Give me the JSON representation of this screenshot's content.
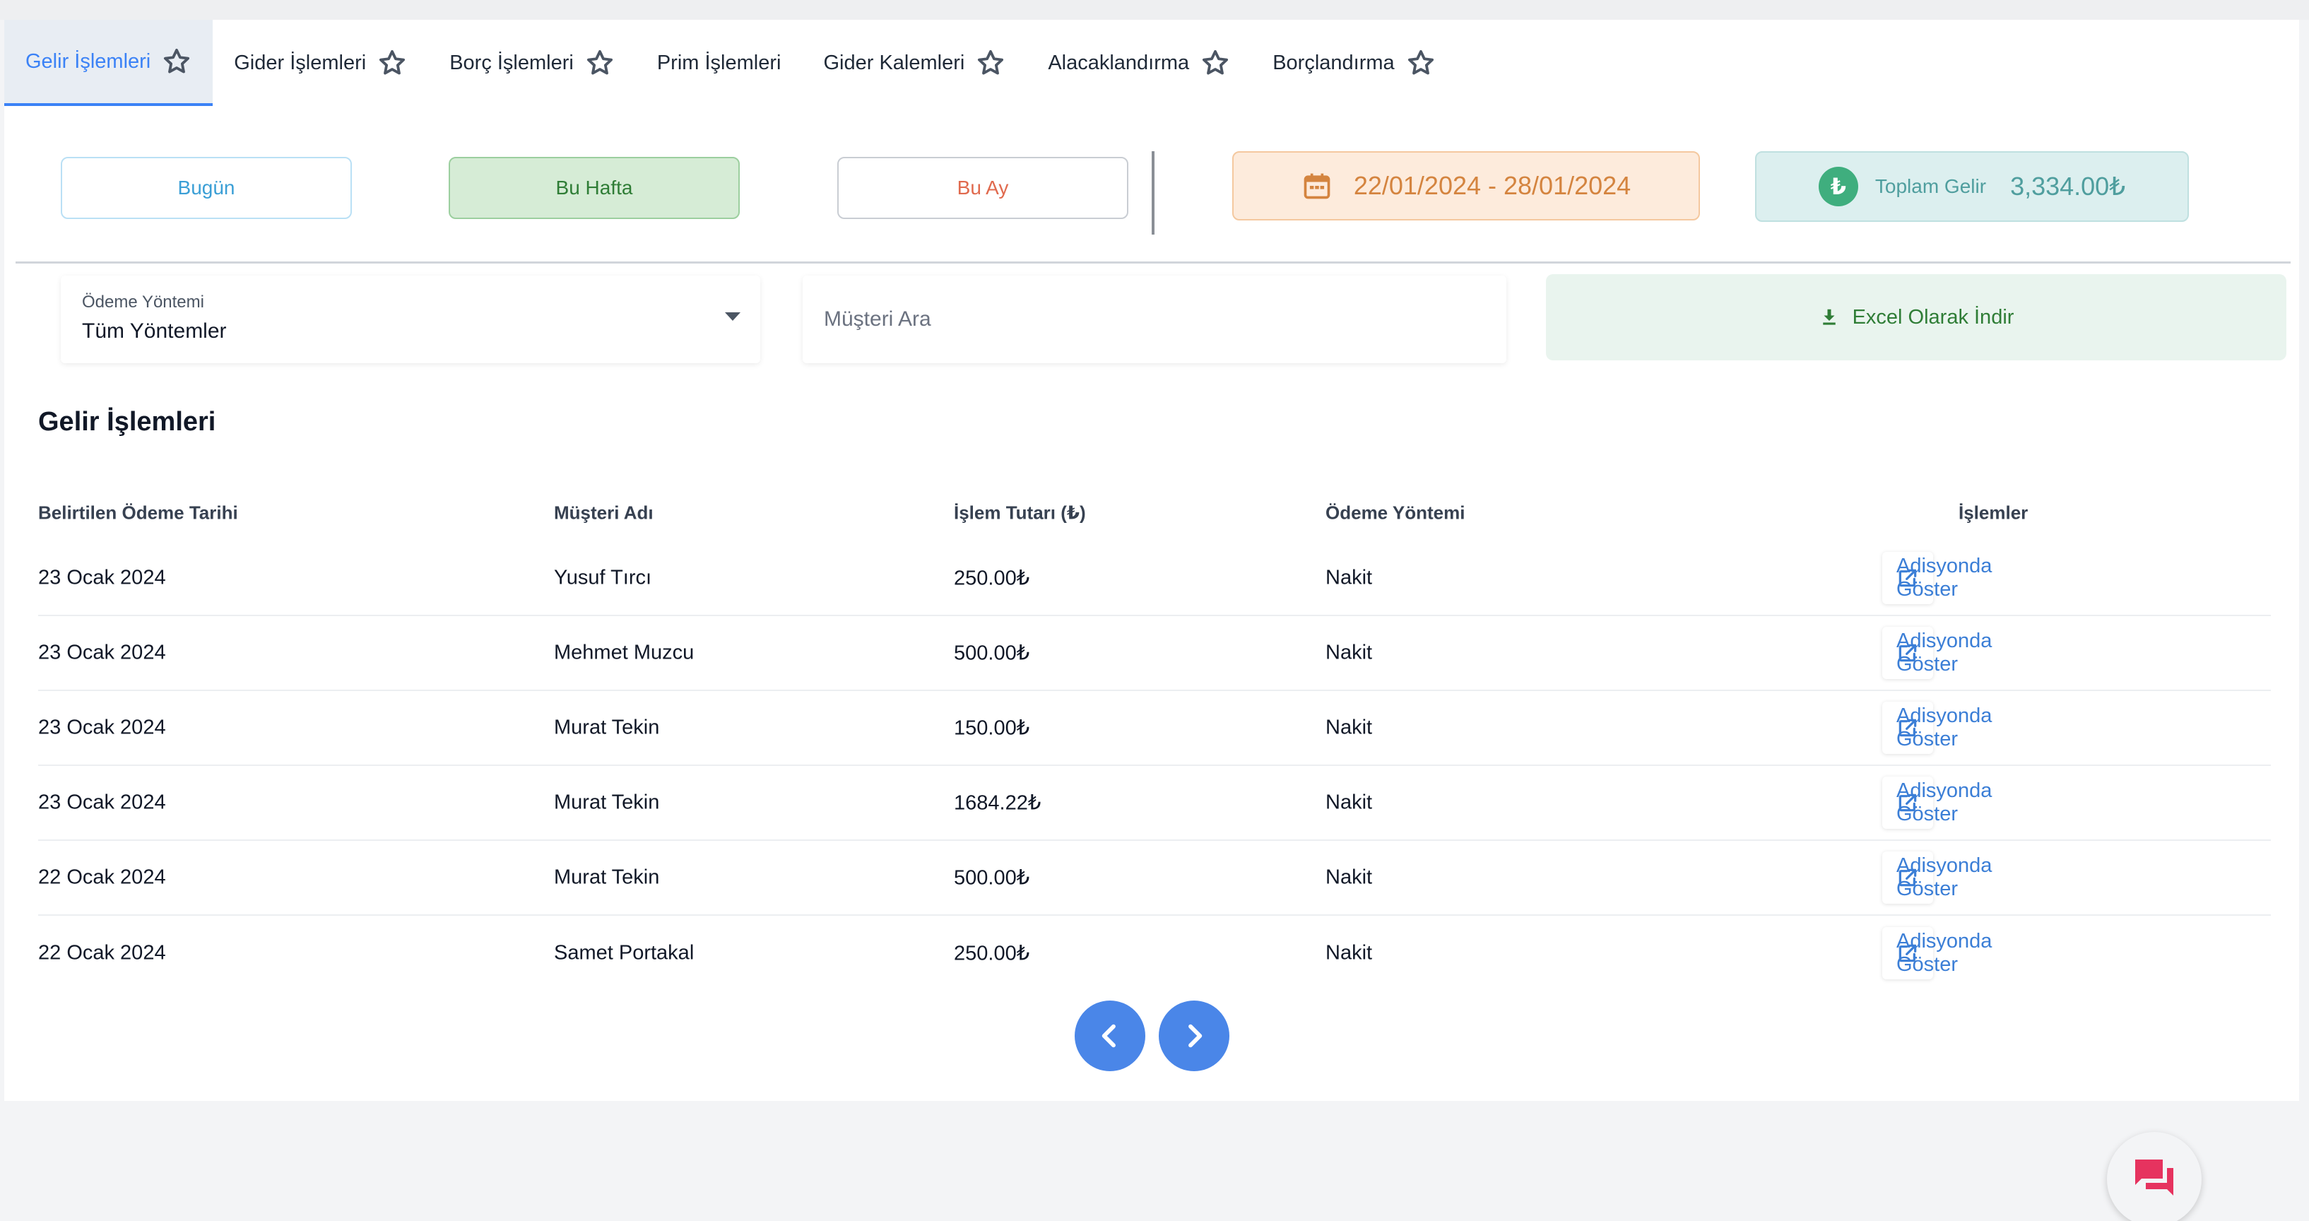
{
  "tabs": [
    {
      "label": "Gelir İşlemleri",
      "active": true,
      "star": true
    },
    {
      "label": "Gider İşlemleri",
      "active": false,
      "star": true
    },
    {
      "label": "Borç İşlemleri",
      "active": false,
      "star": true
    },
    {
      "label": "Prim İşlemleri",
      "active": false,
      "star": false
    },
    {
      "label": "Gider Kalemleri",
      "active": false,
      "star": true
    },
    {
      "label": "Alacaklandırma",
      "active": false,
      "star": true
    },
    {
      "label": "Borçlandırma",
      "active": false,
      "star": true
    }
  ],
  "period": {
    "today": "Bugün",
    "week": "Bu Hafta",
    "month": "Bu Ay",
    "selected": "Bu Hafta"
  },
  "date_range": "22/01/2024 - 28/01/2024",
  "total": {
    "icon": "turkish-lira-icon",
    "symbol": "₺",
    "label": "Toplam Gelir",
    "value": "3,334.00₺"
  },
  "filters": {
    "payment_label": "Ödeme Yöntemi",
    "payment_value": "Tüm Yöntemler",
    "search_placeholder": "Müşteri Ara",
    "search_value": "",
    "excel_label": "Excel Olarak İndir"
  },
  "table": {
    "title": "Gelir İşlemleri",
    "headers": {
      "date": "Belirtilen Ödeme Tarihi",
      "customer": "Müşteri Adı",
      "amount": "İşlem Tutarı (₺)",
      "method": "Ödeme Yöntemi",
      "actions": "İşlemler"
    },
    "action_label": "Adisyonda Göster",
    "rows": [
      {
        "date": "23 Ocak 2024",
        "customer": "Yusuf Tırcı",
        "amount": "250.00₺",
        "method": "Nakit"
      },
      {
        "date": "23 Ocak 2024",
        "customer": "Mehmet Muzcu",
        "amount": "500.00₺",
        "method": "Nakit"
      },
      {
        "date": "23 Ocak 2024",
        "customer": "Murat Tekin",
        "amount": "150.00₺",
        "method": "Nakit"
      },
      {
        "date": "23 Ocak 2024",
        "customer": "Murat Tekin",
        "amount": "1684.22₺",
        "method": "Nakit"
      },
      {
        "date": "22 Ocak 2024",
        "customer": "Murat Tekin",
        "amount": "500.00₺",
        "method": "Nakit"
      },
      {
        "date": "22 Ocak 2024",
        "customer": "Samet Portakal",
        "amount": "250.00₺",
        "method": "Nakit"
      }
    ]
  },
  "colors": {
    "accent": "#3b82f6",
    "pagination": "#4a86e8",
    "chat": "#e6335f",
    "success": "#2f7d36"
  }
}
